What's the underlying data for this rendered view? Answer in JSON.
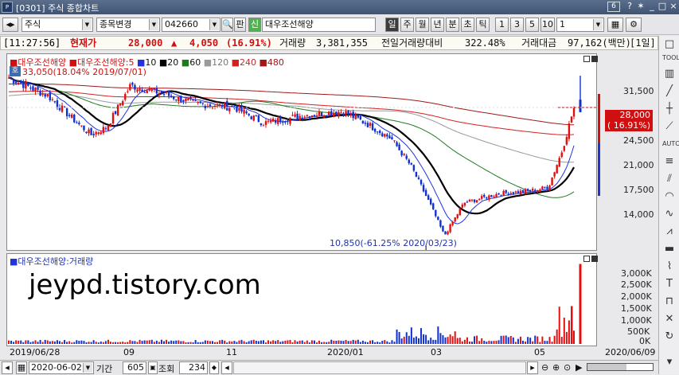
{
  "window": {
    "title": "[0301] 주식 종합차트",
    "screen_number": "6"
  },
  "toolbar": {
    "market": "주식",
    "change_item": "종목변경",
    "stock_code": "042660",
    "ticker_short": "판",
    "credit_tag": "신",
    "stock_name": "대우조선해양",
    "periods": [
      "일",
      "주",
      "월",
      "년",
      "분",
      "초",
      "틱"
    ],
    "selected_period": "일",
    "intervals": [
      "1",
      "3",
      "5",
      "10"
    ],
    "interval_value": "1"
  },
  "info": {
    "time": "[11:27:56]",
    "price_label": "현재가",
    "price": "28,000",
    "change_arrow": "▲",
    "change": "4,050",
    "change_pct": "(16.91%)",
    "volume_label": "거래량",
    "volume": "3,381,355",
    "prev_ratio_label": "전일거래량대비",
    "prev_ratio": "322.48%",
    "amount_label": "거래대금",
    "amount": "97,162(백만)",
    "period_tag": "[1일]"
  },
  "price_panel": {
    "legend_stock": "대우조선해양",
    "legend_ma_stock": "대우조선해양:5",
    "ma_labels": [
      "10",
      "20",
      "60",
      "120",
      "240",
      "480"
    ],
    "ma_colors": [
      "#2233dd",
      "#000000",
      "#1f7a1f",
      "#999999",
      "#d42020",
      "#a01818"
    ],
    "high_badge": "호",
    "high_note": "33,050(18.04% 2019/07/01)",
    "low_note": "10,850(-61.25% 2020/03/23)",
    "y_ticks": [
      "31,500",
      "28,000",
      "24,500",
      "21,000",
      "17,500",
      "14,000"
    ],
    "current_price": "28,000",
    "current_pct": "( 16.91%)"
  },
  "volume_panel": {
    "legend": "대우조선해양:거래량",
    "y_ticks": [
      "3,000K",
      "2,500K",
      "2,000K",
      "1,500K",
      "1,000K",
      "500K",
      "0K"
    ]
  },
  "x_axis": {
    "labels": [
      "2019/06/28",
      "09",
      "11",
      "2020/01",
      "03",
      "05"
    ],
    "end_date": "2020/06/09"
  },
  "bottom": {
    "date": "2020-06-02",
    "period_label": "기간",
    "period_value": "605",
    "view_label": "조회",
    "view_value": "234"
  },
  "watermark": "jeypd.tistory.com",
  "chart_data": {
    "type": "candlestick",
    "title": "",
    "xlabel": "",
    "ylabel": "",
    "ylim": [
      11000,
      34000
    ],
    "volume_ylim": [
      0,
      3400000
    ],
    "dates": [
      "2019/07",
      "2019/08",
      "2019/09",
      "2019/10",
      "2019/11",
      "2019/12",
      "2020/01",
      "2020/02",
      "2020/03",
      "2020/04",
      "2020/05",
      "2020/06"
    ],
    "close": [
      30000,
      25000,
      30000,
      28500,
      27000,
      26000,
      27000,
      23500,
      11500,
      16500,
      17200,
      28000
    ],
    "high_mark": {
      "value": 33050,
      "date": "2019/07/01"
    },
    "low_mark": {
      "value": 10850,
      "date": "2020/03/23"
    },
    "current": {
      "value": 28000,
      "date": "2020/06/09"
    },
    "volume": [
      {
        "date": "2019/07",
        "value": 150000
      },
      {
        "date": "2019/10",
        "value": 120000
      },
      {
        "date": "2020/01",
        "value": 110000
      },
      {
        "date": "2020/03",
        "value": 700000
      },
      {
        "date": "2020/04",
        "value": 450000
      },
      {
        "date": "2020/05",
        "value": 260000
      },
      {
        "date": "2020/06/05",
        "value": 1600000
      },
      {
        "date": "2020/06/09",
        "value": 3381355
      }
    ]
  }
}
